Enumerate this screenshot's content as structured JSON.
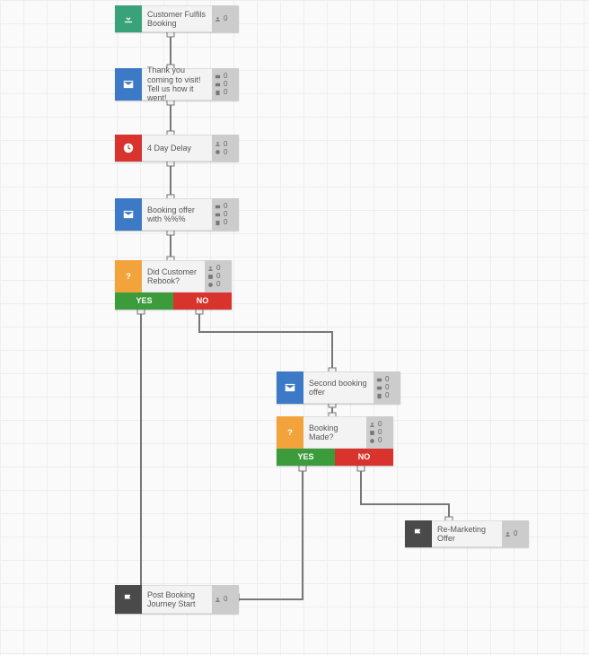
{
  "nodes": {
    "n1": {
      "label": "Customer Fulfils Booking",
      "stats": [
        "0"
      ]
    },
    "n2": {
      "label": "Thank you coming to visit! Tell us how it went!",
      "stats": [
        "0",
        "0",
        "0"
      ]
    },
    "n3": {
      "label": "4 Day Delay",
      "stats": [
        "0",
        "0"
      ]
    },
    "n4": {
      "label": "Booking offer with %%%",
      "stats": [
        "0",
        "0",
        "0"
      ]
    },
    "n5": {
      "label": "Did Customer Rebook?",
      "stats": [
        "0",
        "0",
        "0"
      ]
    },
    "n6": {
      "label": "Second booking offer",
      "stats": [
        "0",
        "0",
        "0"
      ]
    },
    "n7": {
      "label": "Booking Made?",
      "stats": [
        "0",
        "0",
        "0"
      ]
    },
    "n8": {
      "label": "Re-Marketing Offer",
      "stats": [
        "0"
      ]
    },
    "n9": {
      "label": "Post Booking Journey Start",
      "stats": [
        "0"
      ]
    }
  },
  "branches": {
    "yes_label": "YES",
    "no_label": "NO"
  }
}
